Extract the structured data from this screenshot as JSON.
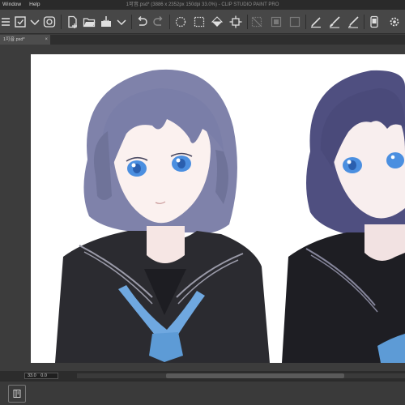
{
  "app": {
    "title": "1可音.psd* (3886 x 2352px 150dpi 33.0%)  - CLIP STUDIO PAINT PRO"
  },
  "menu": {
    "items": [
      "Window",
      "Help"
    ]
  },
  "toolbar": {
    "icons": [
      "menu-icon",
      "save-icon",
      "chevron-down-icon",
      "cloud-sync-icon",
      "new-file-icon",
      "open-folder-icon",
      "save-file-icon",
      "chevron-down-icon",
      "undo-icon",
      "redo-icon",
      "clear-icon",
      "selection-icon",
      "fill-icon",
      "crop-icon",
      "deselect-icon",
      "invert-selection-icon",
      "transform-icon",
      "pen-icon",
      "brush-icon",
      "eraser-icon",
      "smartphone-icon",
      "settings-icon"
    ]
  },
  "document": {
    "tab_label": "1可音.psd*",
    "close_glyph": "×"
  },
  "status": {
    "zoom": "33.0",
    "rotation": "0.0"
  }
}
